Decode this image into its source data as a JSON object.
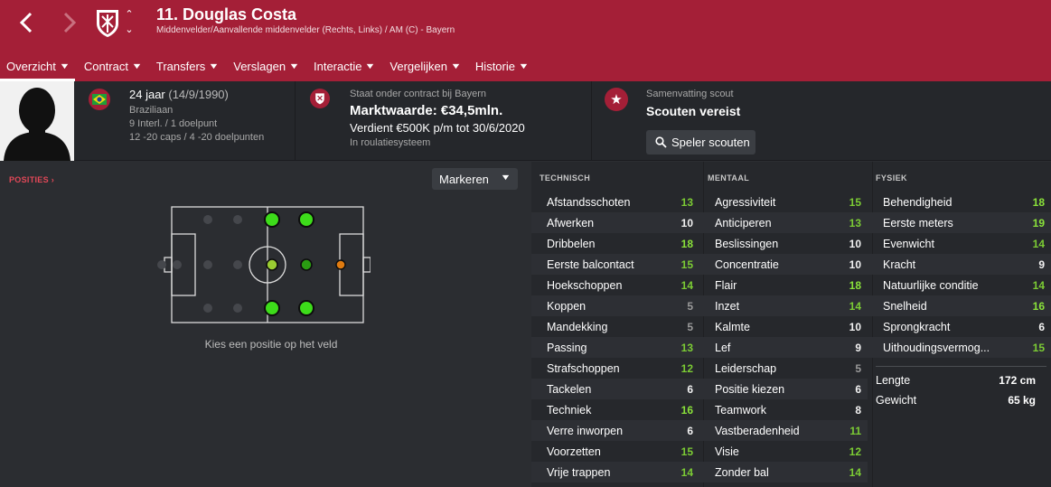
{
  "header": {
    "title": "11. Douglas Costa",
    "subtitle": "Middenvelder/Aanvallende middenvelder (Rechts, Links) / AM (C) - Bayern",
    "colors": {
      "brand": "#a41f37",
      "background": "#2b2d31"
    },
    "icons": {
      "back": "chevron-left-icon",
      "forward": "chevron-right-icon",
      "club": "club-crest-icon"
    }
  },
  "tabs": [
    {
      "label": "Overzicht",
      "active": true
    },
    {
      "label": "Contract"
    },
    {
      "label": "Transfers"
    },
    {
      "label": "Verslagen"
    },
    {
      "label": "Interactie"
    },
    {
      "label": "Vergelijken"
    },
    {
      "label": "Historie"
    }
  ],
  "info": {
    "age": "24 jaar",
    "dob": "(14/9/1990)",
    "nationality": "Braziliaan",
    "intl": "9 Interl. / 1 doelpunt",
    "u20": "12 -20 caps / 4 -20 doelpunten",
    "contract_status": "Staat onder contract bij Bayern",
    "market_value": "Marktwaarde: €34,5mln.",
    "wage": "Verdient €500K p/m tot 30/6/2020",
    "role": "In roulatiesysteem",
    "scout_label": "Samenvatting scout",
    "scout_status": "Scouten vereist",
    "scout_button": "Speler scouten"
  },
  "positions": {
    "label": "POSITIES",
    "dropdown": "Markeren",
    "hint": "Kies een positie op het veld",
    "legend_colors": {
      "natural": "#3ddc1a",
      "accomplished": "#9acd32",
      "competent": "#2a9d12",
      "unconvincing": "#e07b10",
      "none": "#45474c"
    }
  },
  "technical": {
    "title": "TECHNISCH",
    "items": [
      {
        "name": "Afstandsschoten",
        "value": "13"
      },
      {
        "name": "Afwerken",
        "value": "10"
      },
      {
        "name": "Dribbelen",
        "value": "18"
      },
      {
        "name": "Eerste balcontact",
        "value": "15"
      },
      {
        "name": "Hoekschoppen",
        "value": "14"
      },
      {
        "name": "Koppen",
        "value": "5"
      },
      {
        "name": "Mandekking",
        "value": "5"
      },
      {
        "name": "Passing",
        "value": "13"
      },
      {
        "name": "Strafschoppen",
        "value": "12"
      },
      {
        "name": "Tackelen",
        "value": "6"
      },
      {
        "name": "Techniek",
        "value": "16"
      },
      {
        "name": "Verre inworpen",
        "value": "6"
      },
      {
        "name": "Voorzetten",
        "value": "15"
      },
      {
        "name": "Vrije trappen",
        "value": "14"
      }
    ]
  },
  "mental": {
    "title": "MENTAAL",
    "items": [
      {
        "name": "Agressiviteit",
        "value": "15"
      },
      {
        "name": "Anticiperen",
        "value": "13"
      },
      {
        "name": "Beslissingen",
        "value": "10"
      },
      {
        "name": "Concentratie",
        "value": "10"
      },
      {
        "name": "Flair",
        "value": "18"
      },
      {
        "name": "Inzet",
        "value": "14"
      },
      {
        "name": "Kalmte",
        "value": "10"
      },
      {
        "name": "Lef",
        "value": "9"
      },
      {
        "name": "Leiderschap",
        "value": "5"
      },
      {
        "name": "Positie kiezen",
        "value": "6"
      },
      {
        "name": "Teamwork",
        "value": "8"
      },
      {
        "name": "Vastberadenheid",
        "value": "11"
      },
      {
        "name": "Visie",
        "value": "12"
      },
      {
        "name": "Zonder bal",
        "value": "14"
      }
    ]
  },
  "physical": {
    "title": "FYSIEK",
    "items": [
      {
        "name": "Behendigheid",
        "value": "18"
      },
      {
        "name": "Eerste meters",
        "value": "19"
      },
      {
        "name": "Evenwicht",
        "value": "14"
      },
      {
        "name": "Kracht",
        "value": "9"
      },
      {
        "name": "Natuurlijke conditie",
        "value": "14"
      },
      {
        "name": "Snelheid",
        "value": "16"
      },
      {
        "name": "Sprongkracht",
        "value": "6"
      },
      {
        "name": "Uithoudingsvermog...",
        "value": "15"
      }
    ],
    "height_label": "Lengte",
    "height": "172 cm",
    "weight_label": "Gewicht",
    "weight": "65 kg"
  }
}
